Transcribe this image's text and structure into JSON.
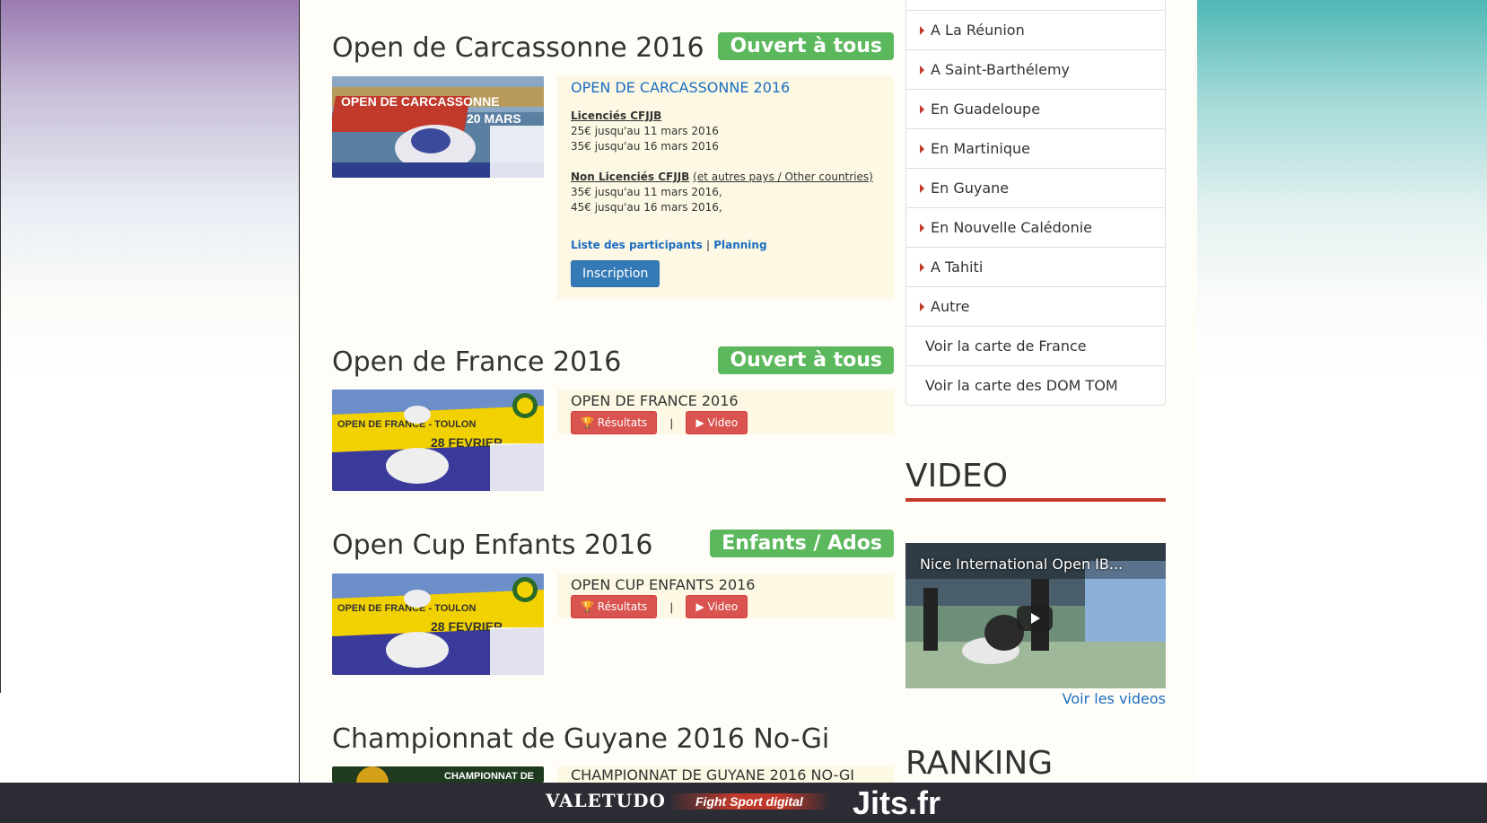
{
  "events": [
    {
      "title": "Open de Carcassonne 2016",
      "badge": "Ouvert à tous",
      "banner_text": "OPEN DE CARCASSONNE",
      "banner_sub": "20 MARS",
      "box_title": "OPEN DE CARCASSONNE 2016",
      "licensed_label": "Licenciés CFJJB",
      "licensed_prices": [
        "25€ jusqu'au 11 mars 2016",
        "35€ jusqu'au 16 mars 2016"
      ],
      "unlicensed_label": "Non Licenciés CFJJB",
      "unlicensed_note": "(et autres pays / Other countries)",
      "unlicensed_prices": [
        "35€ jusqu'au 11 mars 2016,",
        "45€ jusqu'au 16 mars 2016,"
      ],
      "participants_link": "Liste des participants",
      "separator": "|",
      "planning_link": "Planning",
      "register_button": "Inscription"
    },
    {
      "title": "Open de France 2016",
      "badge": "Ouvert à tous",
      "banner_text": "OPEN DE FRANCE - TOULON",
      "banner_sub": "28 FEVRIER",
      "box_title": "OPEN DE FRANCE 2016",
      "results_button": "Résultats",
      "separator": "|",
      "video_button": "Video"
    },
    {
      "title": "Open Cup Enfants 2016",
      "badge": "Enfants / Ados",
      "banner_text": "OPEN DE FRANCE - TOULON",
      "banner_sub": "28 FEVRIER",
      "box_title": "OPEN CUP ENFANTS 2016",
      "results_button": "Résultats",
      "separator": "|",
      "video_button": "Video"
    },
    {
      "title": "Championnat de Guyane 2016 No-Gi",
      "banner_text": "CHAMPIONNAT DE",
      "box_title": "CHAMPIONNAT DE GUYANE 2016 NO-GI"
    }
  ],
  "sidebar": {
    "nav_items": [
      {
        "label": "A La Réunion",
        "caret": true
      },
      {
        "label": "A Saint-Barthélemy",
        "caret": true
      },
      {
        "label": "En Guadeloupe",
        "caret": true
      },
      {
        "label": "En Martinique",
        "caret": true
      },
      {
        "label": "En Guyane",
        "caret": true
      },
      {
        "label": "En Nouvelle Calédonie",
        "caret": true
      },
      {
        "label": "A Tahiti",
        "caret": true
      },
      {
        "label": "Autre",
        "caret": true
      },
      {
        "label": "Voir la carte de France",
        "caret": false
      },
      {
        "label": "Voir la carte des DOM TOM",
        "caret": false
      }
    ],
    "video_heading": "VIDEO",
    "video_title": "Nice International Open IB...",
    "see_videos_link": "Voir les videos",
    "ranking_heading": "RANKING"
  },
  "footer": {
    "logos": [
      "VALETUDO",
      "Fight Sport digital",
      "Jits.fr"
    ]
  },
  "colors": {
    "badge_green": "#5cb85c",
    "link_blue": "#1b6ec2",
    "button_blue": "#337ab7",
    "button_red": "#d9534f",
    "accent_red": "#c0392b",
    "box_cream": "#fcf8e3"
  }
}
